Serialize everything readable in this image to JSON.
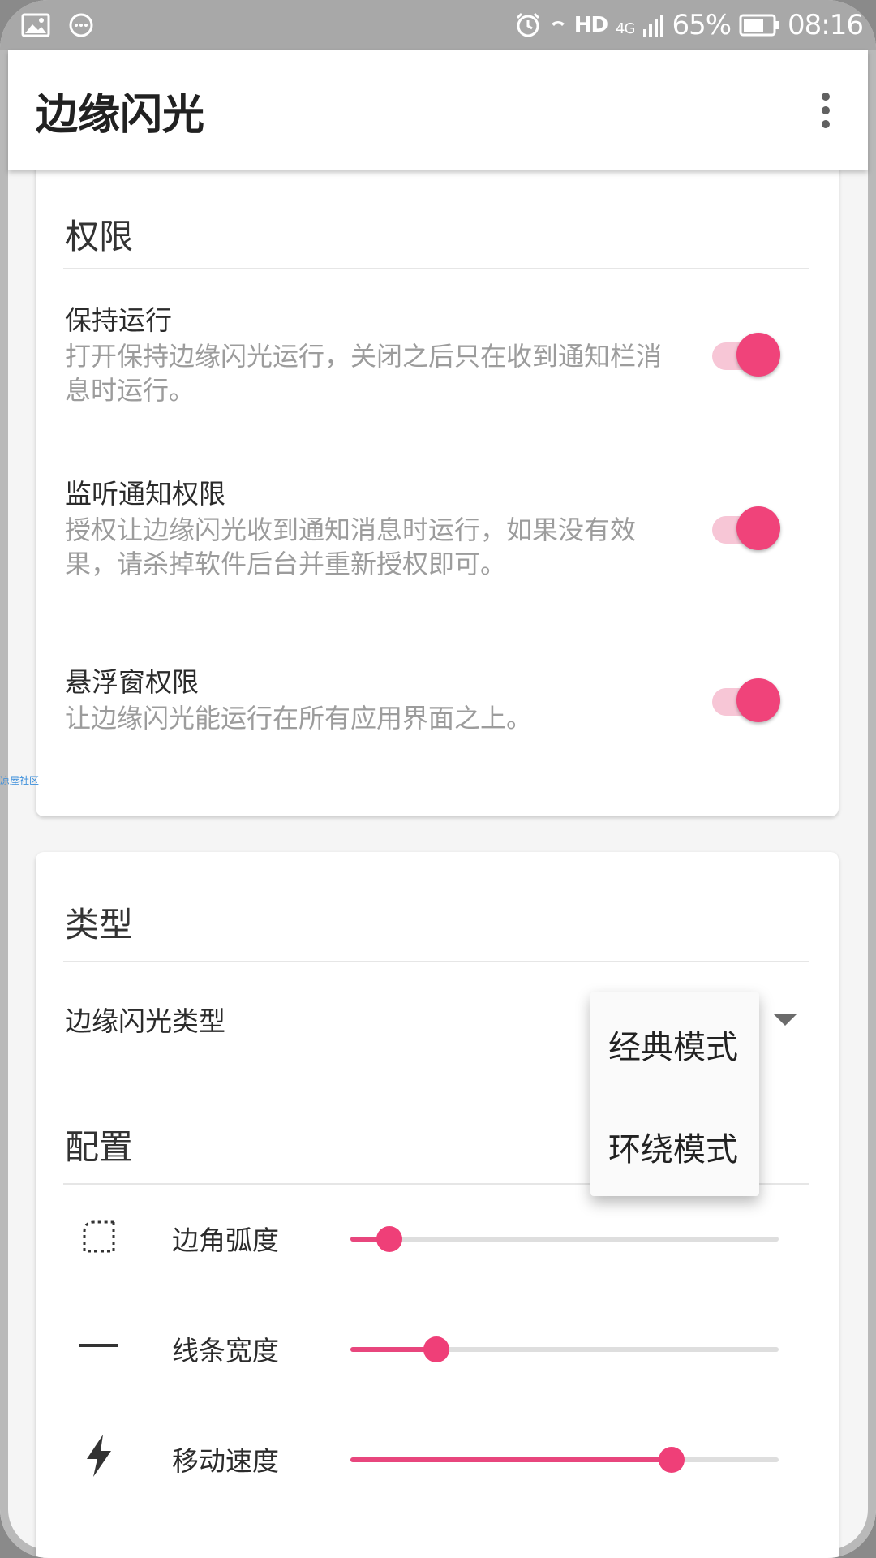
{
  "status_bar": {
    "icons_left": [
      "image-icon",
      "chat-bubble-icon"
    ],
    "hd_label": "HD",
    "network_label": "4G",
    "battery_percent": "65%",
    "time": "08:16"
  },
  "app_bar": {
    "title": "边缘闪光",
    "overflow_icon": "overflow-menu-icon"
  },
  "permissions": {
    "title": "权限",
    "items": [
      {
        "title": "保持运行",
        "summary": "打开保持边缘闪光运行，关闭之后只在收到通知栏消息时运行。",
        "enabled": true
      },
      {
        "title": "监听通知权限",
        "summary": "授权让边缘闪光收到通知消息时运行，如果没有效果，请杀掉软件后台并重新授权即可。",
        "enabled": true
      },
      {
        "title": "悬浮窗权限",
        "summary": "让边缘闪光能运行在所有应用界面之上。",
        "enabled": true
      }
    ]
  },
  "watermark": "凉屋社区",
  "type_section": {
    "title": "类型",
    "spinner_label": "边缘闪光类型",
    "options": [
      "经典模式",
      "环绕模式"
    ]
  },
  "config_section": {
    "title": "配置",
    "sliders": [
      {
        "label": "边角弧度",
        "icon": "rounded-corner-icon",
        "value": 0.09
      },
      {
        "label": "线条宽度",
        "icon": "line-width-icon",
        "value": 0.2
      },
      {
        "label": "移动速度",
        "icon": "lightning-bolt-icon",
        "value": 0.75
      }
    ]
  },
  "colors": {
    "accent": "#f0437a",
    "switch_track": "#f7c6d6",
    "status_bar": "#a8a8a8"
  }
}
